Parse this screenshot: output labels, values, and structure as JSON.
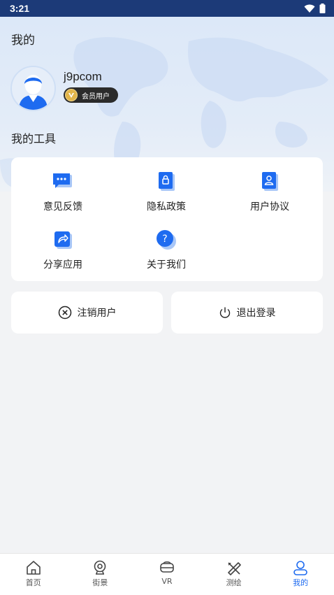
{
  "status_bar": {
    "time": "3:21"
  },
  "page": {
    "title": "我的"
  },
  "profile": {
    "username": "j9pcom",
    "badge_label": "会员用户"
  },
  "tools": {
    "section_title": "我的工具",
    "items": [
      {
        "label": "意见反馈",
        "icon": "feedback-icon"
      },
      {
        "label": "隐私政策",
        "icon": "lock-icon"
      },
      {
        "label": "用户协议",
        "icon": "user-agreement-icon"
      },
      {
        "label": "分享应用",
        "icon": "share-icon"
      },
      {
        "label": "关于我们",
        "icon": "question-icon"
      }
    ]
  },
  "actions": {
    "cancel_account": "注销用户",
    "logout": "退出登录"
  },
  "tab_bar": {
    "items": [
      {
        "label": "首页",
        "icon": "home-icon",
        "active": false
      },
      {
        "label": "街景",
        "icon": "camera-icon",
        "active": false
      },
      {
        "label": "VR",
        "icon": "vr-headset-icon",
        "active": false
      },
      {
        "label": "测绘",
        "icon": "survey-tools-icon",
        "active": false
      },
      {
        "label": "我的",
        "icon": "user-icon",
        "active": true
      }
    ]
  },
  "colors": {
    "accent": "#1e6bf0",
    "status_bar": "#1c3a78",
    "badge_bg": "#2b2b2b",
    "badge_gold": "#e2b54a"
  }
}
